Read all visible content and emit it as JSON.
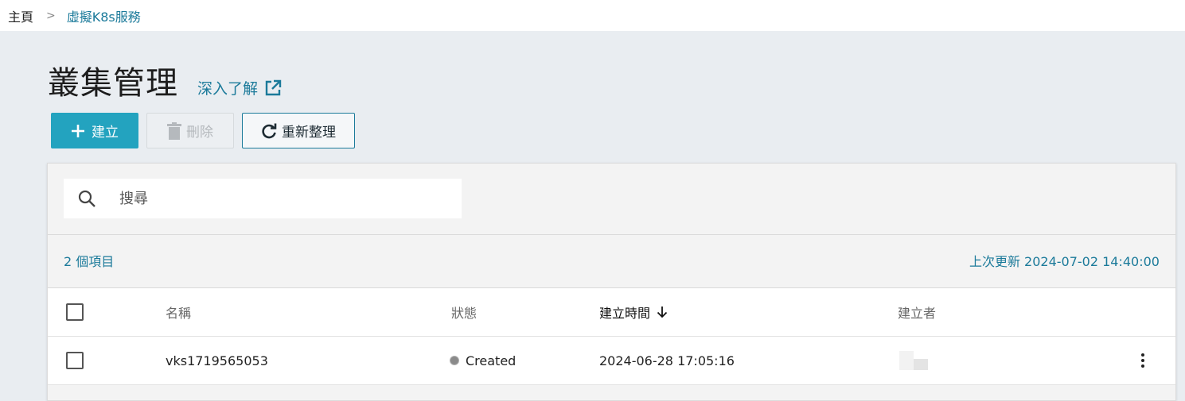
{
  "breadcrumb": {
    "home": "主頁",
    "separator": ">",
    "current": "虛擬K8s服務"
  },
  "page": {
    "title": "叢集管理",
    "learn_more": "深入了解",
    "learn_more_icon": "external-link-icon"
  },
  "toolbar": {
    "create_label": "建立",
    "create_icon": "plus-icon",
    "delete_label": "刪除",
    "delete_icon": "trash-icon",
    "refresh_label": "重新整理",
    "refresh_icon": "refresh-icon"
  },
  "search": {
    "placeholder": "搜尋",
    "value": "",
    "icon": "search-icon"
  },
  "summary": {
    "item_count": "2 個項目",
    "last_updated": "上次更新 2024-07-02 14:40:00"
  },
  "table": {
    "headers": {
      "name": "名稱",
      "status": "狀態",
      "created_at": "建立時間",
      "creator": "建立者"
    },
    "sort": {
      "column": "created_at",
      "direction": "desc"
    },
    "rows": [
      {
        "name": "vks1719565053",
        "status": "Created",
        "created_at": "2024-06-28 17:05:16",
        "creator": ""
      }
    ]
  },
  "colors": {
    "accent": "#23a3bf",
    "link": "#1b7a9a",
    "page_bg": "#e9edf1",
    "status_created": "#8a8a8a"
  }
}
